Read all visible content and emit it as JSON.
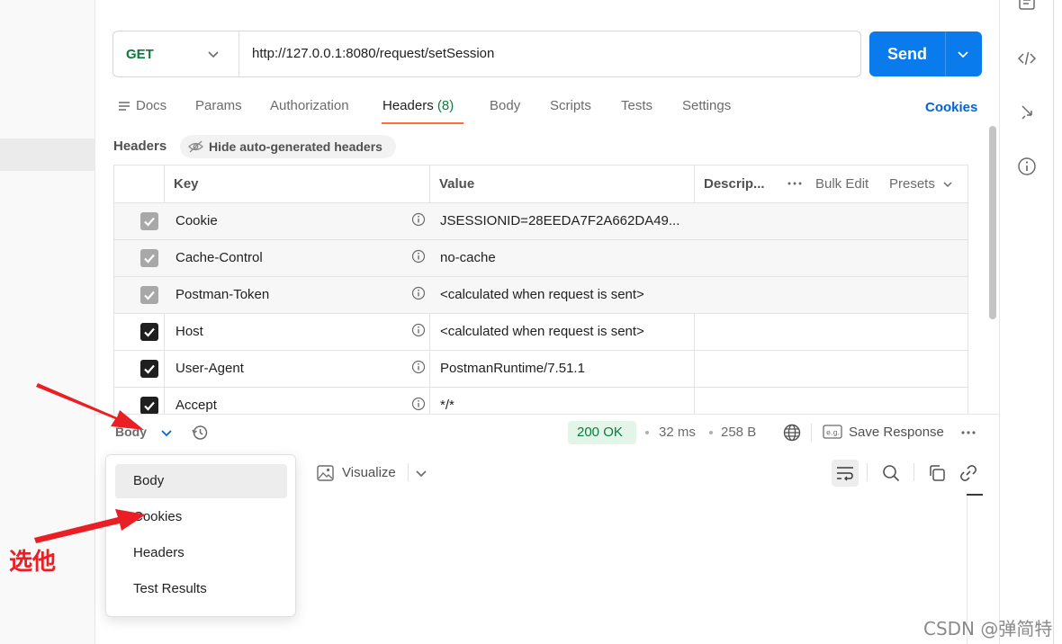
{
  "request": {
    "method": "GET",
    "url": "http://127.0.0.1:8080/request/setSession",
    "send_label": "Send"
  },
  "tabs": [
    {
      "label": "Docs"
    },
    {
      "label": "Params"
    },
    {
      "label": "Authorization"
    },
    {
      "label": "Headers",
      "count": "(8)",
      "active": true
    },
    {
      "label": "Body"
    },
    {
      "label": "Scripts"
    },
    {
      "label": "Tests"
    },
    {
      "label": "Settings"
    }
  ],
  "cookies_link": "Cookies",
  "headers_section": {
    "label": "Headers",
    "hide_auto_label": "Hide auto-generated headers",
    "columns": {
      "key": "Key",
      "value": "Value",
      "description": "Descrip..."
    },
    "bulk_edit": "Bulk Edit",
    "presets": "Presets",
    "rows": [
      {
        "key": "Cookie",
        "value": "JSESSIONID=28EEDA7F2A662DA49...",
        "checked": true,
        "disabled": true
      },
      {
        "key": "Cache-Control",
        "value": "no-cache",
        "checked": true,
        "disabled": true
      },
      {
        "key": "Postman-Token",
        "value": "<calculated when request is sent>",
        "checked": true,
        "disabled": true
      },
      {
        "key": "Host",
        "value": "<calculated when request is sent>",
        "checked": true,
        "disabled": false
      },
      {
        "key": "User-Agent",
        "value": "PostmanRuntime/7.51.1",
        "checked": true,
        "disabled": false
      },
      {
        "key": "Accept",
        "value": "*/*",
        "checked": true,
        "disabled": false
      }
    ]
  },
  "response": {
    "view_selector": "Body",
    "status": "200 OK",
    "time": "32 ms",
    "size": "258 B",
    "save_response": "Save Response",
    "visualize": "Visualize",
    "dropdown_items": [
      "Body",
      "Cookies",
      "Headers",
      "Test Results"
    ]
  },
  "annotation": {
    "text": "选他",
    "color": "#ea1f25"
  },
  "watermark": "CSDN @弹简特",
  "colors": {
    "accent": "#ff6c37",
    "send": "#097bed",
    "method_green": "#0b7a3e",
    "link_blue": "#0265d2"
  }
}
